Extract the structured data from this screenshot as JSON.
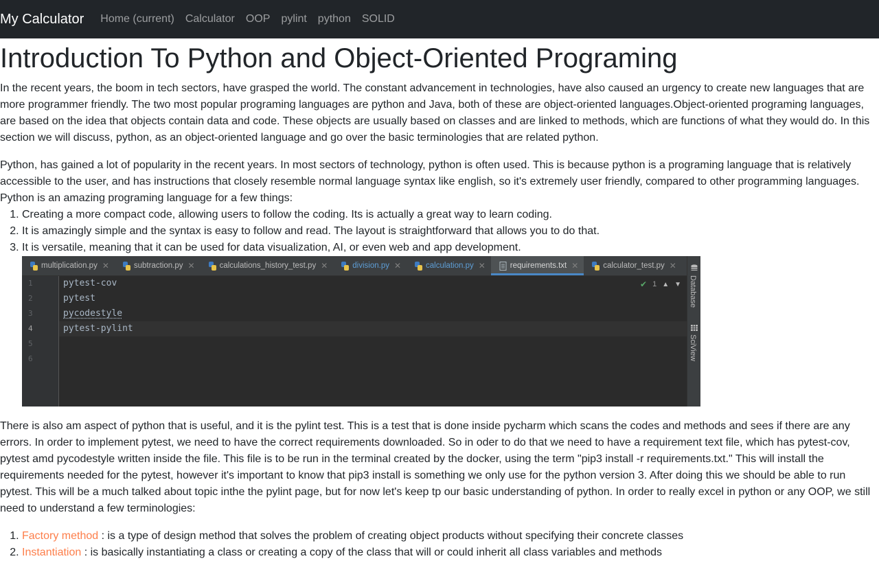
{
  "navbar": {
    "brand": "My Calculator",
    "links": [
      "Home (current)",
      "Calculator",
      "OOP",
      "pylint",
      "python",
      "SOLID"
    ]
  },
  "main": {
    "title": "Introduction To Python and Object-Oriented Programing",
    "para1": "In the recent years, the boom in tech sectors, have grasped the world. The constant advancement in technologies, have also caused an urgency to create new languages that are more programmer friendly. The two most popular programing languages are python and Java, both of these are object-oriented languages.Object-oriented programing languages, are based on the idea that objects contain data and code. These objects are usually based on classes and are linked to methods, which are functions of what they would do. In this section we will discuss, python, as an object-oriented language and go over the basic terminologies that are related python.",
    "para2": "Python, has gained a lot of popularity in the recent years. In most sectors of technology, python is often used. This is because python is a programing language that is relatively accessible to the user, and has instructions that closely resemble normal language syntax like english, so it's extremely user friendly, compared to other programming languages.",
    "para2b": "Python is an amazing programing language for a few things:",
    "list1": [
      "Creating a more compact code, allowing users to follow the coding. Its is actually a great way to learn coding.",
      "It is amazingly simple and the syntax is easy to follow and read. The layout is straightforward that allows you to do that.",
      "It is versatile, meaning that it can be used for data visualization, AI, or even web and app development."
    ],
    "para3": "There is also am aspect of python that is useful, and it is the pylint test. This is a test that is done inside pycharm which scans the codes and methods and sees if there are any errors. In order to implement pytest, we need to have the correct requirements downloaded. So in oder to do that we need to have a requirement text file, which has pytest-cov, pytest amd pycodestyle written inside the file. This file is to be run in the terminal created by the docker, using the term \"pip3 install -r requirements.txt.\" This will install the requirements needed for the pytest, however it's important to know that pip3 install is something we only use for the python version 3. After doing this we should be able to run pytest. This will be a much talked about topic inthe the pylint page, but for now let's keep tp our basic understanding of python. In order to really excel in python or any OOP, we still need to understand a few terminologies:",
    "terms": [
      {
        "term": "Factory method",
        "desc": " : is a type of design method that solves the problem of creating object products without specifying their concrete classes"
      },
      {
        "term": "Instantiation",
        "desc": " : is basically instantiating a class or creating a copy of the class that will or could inherit all class variables and methods"
      }
    ]
  },
  "ide": {
    "tabs": [
      {
        "label": "multiplication.py",
        "style": "normal"
      },
      {
        "label": "subtraction.py",
        "style": "normal"
      },
      {
        "label": "calculations_history_test.py",
        "style": "normal"
      },
      {
        "label": "division.py",
        "style": "blue"
      },
      {
        "label": "calculation.py",
        "style": "blue"
      },
      {
        "label": "requirements.txt",
        "style": "active"
      },
      {
        "label": "calculator_test.py",
        "style": "normal"
      }
    ],
    "line_numbers": [
      "1",
      "2",
      "3",
      "4",
      "5",
      "6"
    ],
    "code": [
      "pytest-cov",
      "pytest",
      "pycodestyle",
      "pytest-pylint"
    ],
    "inspection_count": "1",
    "side_labels": [
      "Database",
      "SciView"
    ],
    "colors": {
      "editor_bg": "#2b2b2b",
      "tab_bg": "#3c3f41",
      "active_tab_underline": "#4a88c7",
      "code_text": "#a9b7c6"
    }
  },
  "colors": {
    "navbar_bg": "#212529",
    "link_accent": "#fd7e4a"
  }
}
